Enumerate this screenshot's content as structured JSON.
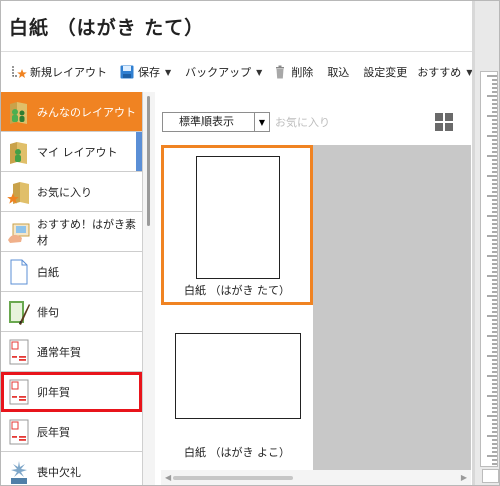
{
  "window": {
    "title": "白紙 （はがき たて）"
  },
  "toolbar": {
    "items": [
      {
        "label": "新規レイアウト",
        "icon": "new-layout-icon",
        "caret": ""
      },
      {
        "label": "保存",
        "icon": "save-icon",
        "caret": "▼"
      },
      {
        "label": "バックアップ",
        "icon": "",
        "caret": "▼"
      },
      {
        "label": "削除",
        "icon": "delete-icon",
        "caret": ""
      },
      {
        "label": "取込",
        "icon": "",
        "caret": ""
      },
      {
        "label": "設定変更",
        "icon": "",
        "caret": ""
      },
      {
        "label": "おすすめ",
        "icon": "",
        "caret": "▼"
      }
    ]
  },
  "sidebar": {
    "items": [
      {
        "label": "みんなのレイアウト",
        "icon": "community-layout-icon",
        "state": "active",
        "tab_color": "#f08322"
      },
      {
        "label": "マイ レイアウト",
        "icon": "my-layout-icon",
        "state": "normal",
        "tab_color": "#5b8fd6"
      },
      {
        "label": "お気に入り",
        "icon": "favorites-icon",
        "state": "normal",
        "tab_color": ""
      },
      {
        "label": "おすすめ！はがき素材",
        "icon": "recommended-material-icon",
        "state": "normal",
        "tab_color": ""
      },
      {
        "label": "白紙",
        "icon": "blank-page-icon",
        "state": "normal",
        "tab_color": ""
      },
      {
        "label": "俳句",
        "icon": "haiku-icon",
        "state": "normal",
        "tab_color": ""
      },
      {
        "label": "通常年賀",
        "icon": "new-year-card-icon",
        "state": "normal",
        "tab_color": ""
      },
      {
        "label": "卯年賀",
        "icon": "rabbit-year-card-icon",
        "state": "highlighted",
        "tab_color": ""
      },
      {
        "label": "辰年賀",
        "icon": "dragon-year-card-icon",
        "state": "normal",
        "tab_color": ""
      },
      {
        "label": "喪中欠礼",
        "icon": "mourning-card-icon",
        "state": "normal",
        "tab_color": ""
      }
    ]
  },
  "content": {
    "sort": {
      "value": "標準順表示",
      "caret": "▼"
    },
    "favorite_filter": "お気に入り",
    "view_icon": "grid-view-icon",
    "templates": [
      {
        "caption": "白紙 （はがき たて）",
        "selected": true
      },
      {
        "caption": "白紙 （はがき よこ）",
        "selected": false
      }
    ],
    "hscroll": {
      "left_arrow": "◀",
      "right_arrow": "▶"
    }
  },
  "colors": {
    "accent": "#f08322",
    "highlight_box": "#e8141b",
    "my_layout_tab": "#5b8fd6",
    "gallery_background": "#c8c8c8"
  }
}
